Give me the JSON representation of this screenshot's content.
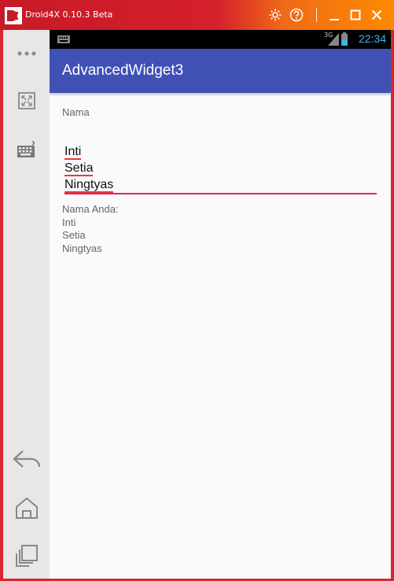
{
  "window": {
    "title": "Droid4X 0.10.3 Beta",
    "colors": {
      "frame": "#d8262f",
      "accent_orange": "#ff8a00"
    },
    "controls": [
      "settings-icon",
      "help-icon",
      "minimize-icon",
      "maximize-icon",
      "close-icon"
    ]
  },
  "sidebar": {
    "items": [
      "more-icon",
      "fullscreen-icon",
      "keyboard-icon",
      "back-icon",
      "home-icon",
      "recents-icon"
    ]
  },
  "statusbar": {
    "time": "22:34",
    "network": "3G"
  },
  "app": {
    "title": "AdvancedWidget3",
    "primary_color": "#3f51b5",
    "accent_color": "#e91e63"
  },
  "form": {
    "label": "Nama",
    "input_lines": [
      "Inti",
      "Setia",
      "Ningtyas"
    ],
    "output_label": "Nama Anda:",
    "output_lines": [
      "Inti",
      "Setia",
      "Ningtyas"
    ]
  }
}
